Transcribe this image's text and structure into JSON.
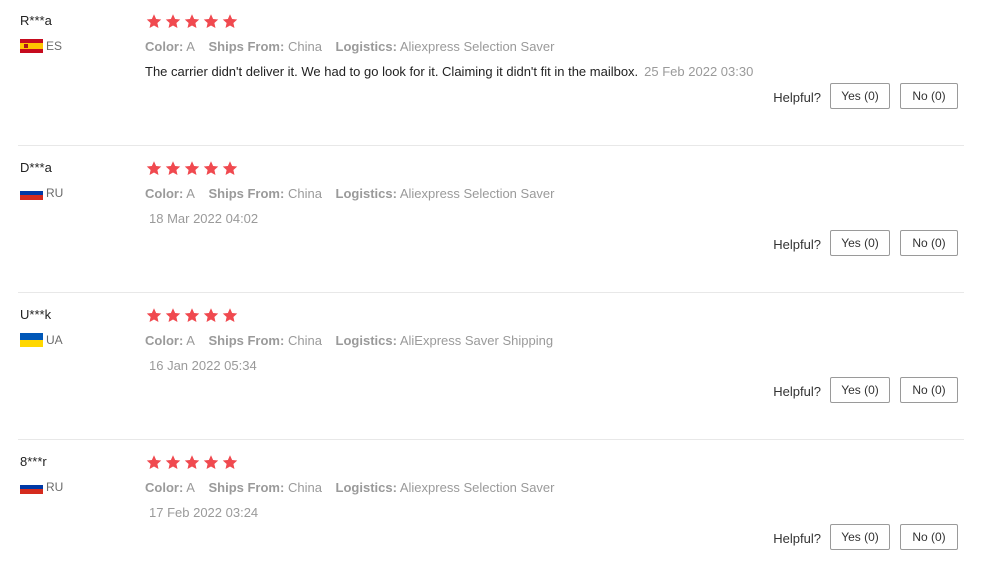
{
  "reviews": [
    {
      "user": "R***a",
      "country": "ES",
      "flag": "flag-es",
      "stars": 5,
      "color_label": "Color:",
      "color_value": "A",
      "ships_label": "Ships From:",
      "ships_value": "China",
      "logistics_label": "Logistics:",
      "logistics_value": "Aliexpress Selection Saver",
      "text": "The carrier didn't deliver it. We had to go look for it. Claiming it didn't fit in the mailbox.",
      "date": "25 Feb 2022 03:30",
      "helpful_label": "Helpful?",
      "yes_label": "Yes (0)",
      "no_label": "No (0)"
    },
    {
      "user": "D***a",
      "country": "RU",
      "flag": "flag-ru",
      "stars": 5,
      "color_label": "Color:",
      "color_value": "A",
      "ships_label": "Ships From:",
      "ships_value": "China",
      "logistics_label": "Logistics:",
      "logistics_value": "Aliexpress Selection Saver",
      "text": "",
      "date": "18 Mar 2022 04:02",
      "helpful_label": "Helpful?",
      "yes_label": "Yes (0)",
      "no_label": "No (0)"
    },
    {
      "user": "U***k",
      "country": "UA",
      "flag": "flag-ua",
      "stars": 5,
      "color_label": "Color:",
      "color_value": "A",
      "ships_label": "Ships From:",
      "ships_value": "China",
      "logistics_label": "Logistics:",
      "logistics_value": "AliExpress Saver Shipping",
      "text": "",
      "date": "16 Jan 2022 05:34",
      "helpful_label": "Helpful?",
      "yes_label": "Yes (0)",
      "no_label": "No (0)"
    },
    {
      "user": "8***r",
      "country": "RU",
      "flag": "flag-ru",
      "stars": 5,
      "color_label": "Color:",
      "color_value": "A",
      "ships_label": "Ships From:",
      "ships_value": "China",
      "logistics_label": "Logistics:",
      "logistics_value": "Aliexpress Selection Saver",
      "text": "",
      "date": "17 Feb 2022 03:24",
      "helpful_label": "Helpful?",
      "yes_label": "Yes (0)",
      "no_label": "No (0)"
    }
  ],
  "colors": {
    "star": "#f0494f",
    "muted_text": "#9a9a9a",
    "divider": "#e8e8e8"
  }
}
